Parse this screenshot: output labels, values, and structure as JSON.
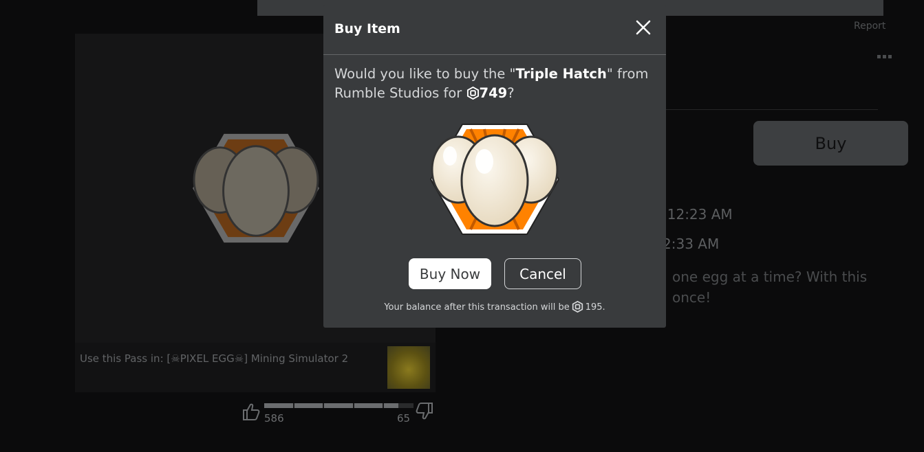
{
  "background": {
    "report_label": "Report",
    "buy_label": "Buy",
    "created_fragment": ":12:23 AM",
    "updated_fragment": "2:33 AM",
    "description_line1": "one egg at a time? With this",
    "description_line2": "once!",
    "use_pass_prefix": "Use this Pass in: [",
    "use_pass_game": "PIXEL EGG",
    "use_pass_suffix": "] Mining Simulator 2",
    "votes": {
      "up": "586",
      "down": "65",
      "up_fraction": 0.9
    }
  },
  "modal": {
    "title": "Buy Item",
    "prompt_before": "Would you like to buy the \"",
    "item_name": "Triple Hatch",
    "prompt_middle": "\" from Rumble Studios for ",
    "price": "749",
    "prompt_end": "?",
    "buy_now_label": "Buy Now",
    "cancel_label": "Cancel",
    "balance_prefix": "Your balance after this transaction will be",
    "balance_value": "195."
  },
  "icons": {
    "close": "close-icon",
    "currency": "robux-icon",
    "thumbs_up": "thumbs-up-icon",
    "thumbs_down": "thumbs-down-icon",
    "more": "more-dots-icon"
  },
  "colors": {
    "modal_bg": "#393b3d",
    "overlay_bg": "#0b0b0c",
    "primary_button": "#ffffff",
    "text": "#d5d7d9",
    "badge_orange": "#ff8200"
  }
}
